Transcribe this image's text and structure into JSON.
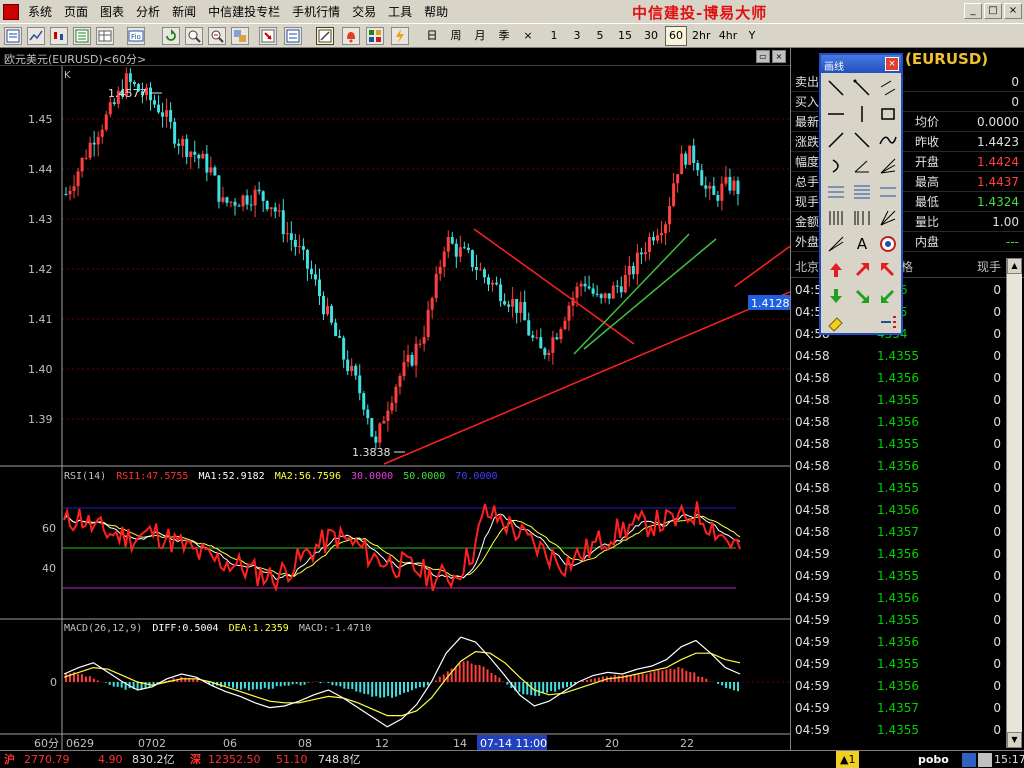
{
  "menu": {
    "items": [
      "系统",
      "页面",
      "图表",
      "分析",
      "新闻",
      "中信建投专栏",
      "手机行情",
      "交易",
      "工具",
      "帮助"
    ],
    "brand": "中信建投-博易大师"
  },
  "window_buttons": [
    "_",
    "□",
    "×"
  ],
  "toolbar": {
    "periods": [
      "日",
      "周",
      "月",
      "季",
      "×",
      "1",
      "3",
      "5",
      "15",
      "30",
      "60",
      "2hr",
      "4hr",
      "Y"
    ],
    "active_period": "60"
  },
  "chart": {
    "title": "欧元美元(EURUSD)<60分>",
    "k_label": "K",
    "high_label": "1.4577",
    "low_label": "1.3838",
    "current_price_label": "1.4128",
    "period_label": "60分",
    "cursor_time": "07-14 11:00",
    "rsi_header": {
      "name": "RSI(14)",
      "rsi1": "RSI1:47.5755",
      "ma1": "MA1:52.9182",
      "ma2": "MA2:56.7596",
      "l30": "30.0000",
      "l50": "50.0000",
      "l70": "70.0000"
    },
    "macd_header": {
      "name": "MACD(26,12,9)",
      "diff": "DIFF:0.5004",
      "dea": "DEA:1.2359",
      "macd": "MACD:-1.4710"
    },
    "colors": {
      "up": "#40e0e0",
      "down": "#ff4040",
      "grid": "#800000",
      "axis_text": "#c0c0c0",
      "rsi_line": "#ff2020",
      "ma1": "#ffffff",
      "ma2": "#ffff40"
    }
  },
  "chart_data": {
    "type": "candlestick",
    "symbol": "EURUSD",
    "interval": "60分",
    "price_axis": {
      "ticks": [
        "1.45",
        "1.44",
        "1.43",
        "1.42",
        "1.41",
        "1.40",
        "1.39"
      ],
      "range": [
        1.381,
        1.459
      ]
    },
    "time_axis_ticks": [
      "0629",
      "0702",
      "06",
      "08",
      "12",
      "14",
      "20",
      "22"
    ],
    "price_path": [
      [
        0,
        1.435
      ],
      [
        12,
        1.44
      ],
      [
        28,
        1.447
      ],
      [
        45,
        1.452
      ],
      [
        58,
        1.4577
      ],
      [
        75,
        1.455
      ],
      [
        92,
        1.452
      ],
      [
        108,
        1.446
      ],
      [
        125,
        1.443
      ],
      [
        140,
        1.44
      ],
      [
        152,
        1.433
      ],
      [
        168,
        1.434
      ],
      [
        185,
        1.435
      ],
      [
        200,
        1.433
      ],
      [
        212,
        1.428
      ],
      [
        225,
        1.424
      ],
      [
        240,
        1.418
      ],
      [
        255,
        1.41
      ],
      [
        270,
        1.402
      ],
      [
        282,
        1.397
      ],
      [
        292,
        1.392
      ],
      [
        300,
        1.3838
      ],
      [
        310,
        1.392
      ],
      [
        322,
        1.398
      ],
      [
        335,
        1.402
      ],
      [
        348,
        1.408
      ],
      [
        358,
        1.416
      ],
      [
        368,
        1.426
      ],
      [
        378,
        1.424
      ],
      [
        392,
        1.422
      ],
      [
        408,
        1.418
      ],
      [
        425,
        1.415
      ],
      [
        440,
        1.412
      ],
      [
        452,
        1.406
      ],
      [
        462,
        1.403
      ],
      [
        475,
        1.407
      ],
      [
        488,
        1.413
      ],
      [
        502,
        1.418
      ],
      [
        518,
        1.413
      ],
      [
        532,
        1.416
      ],
      [
        548,
        1.419
      ],
      [
        560,
        1.424
      ],
      [
        572,
        1.428
      ],
      [
        582,
        1.43
      ],
      [
        592,
        1.44
      ],
      [
        602,
        1.443
      ],
      [
        612,
        1.442
      ],
      [
        620,
        1.436
      ],
      [
        628,
        1.434
      ],
      [
        636,
        1.436
      ],
      [
        644,
        1.437
      ],
      [
        652,
        1.436
      ]
    ],
    "trendlines": [
      {
        "name": "support",
        "from": [
          320,
          1.381
        ],
        "to": [
          780,
          1.42
        ],
        "color": "#ff2020"
      },
      {
        "name": "resistance",
        "from": [
          410,
          1.428
        ],
        "to": [
          570,
          1.405
        ],
        "color": "#ff2020"
      },
      {
        "name": "fan-1",
        "from": [
          510,
          1.403
        ],
        "to": [
          625,
          1.427
        ],
        "color": "#40c040"
      },
      {
        "name": "fan-2",
        "from": [
          520,
          1.404
        ],
        "to": [
          652,
          1.426
        ],
        "color": "#40c040"
      }
    ],
    "rsi": {
      "axis_ticks": [
        "60",
        "40"
      ],
      "levels": {
        "70": "#2020c0",
        "50": "#20c020",
        "30": "#c020c0"
      },
      "path": [
        [
          0,
          62
        ],
        [
          15,
          66
        ],
        [
          30,
          60
        ],
        [
          50,
          57
        ],
        [
          70,
          55
        ],
        [
          90,
          58
        ],
        [
          110,
          53
        ],
        [
          130,
          48
        ],
        [
          150,
          44
        ],
        [
          170,
          42
        ],
        [
          190,
          38
        ],
        [
          210,
          35
        ],
        [
          230,
          42
        ],
        [
          250,
          50
        ],
        [
          270,
          56
        ],
        [
          290,
          52
        ],
        [
          310,
          45
        ],
        [
          330,
          42
        ],
        [
          350,
          40
        ],
        [
          370,
          35
        ],
        [
          390,
          36
        ],
        [
          410,
          50
        ],
        [
          420,
          68
        ],
        [
          440,
          63
        ],
        [
          460,
          55
        ],
        [
          480,
          48
        ],
        [
          500,
          42
        ],
        [
          520,
          48
        ],
        [
          540,
          55
        ],
        [
          560,
          60
        ],
        [
          580,
          62
        ],
        [
          600,
          63
        ],
        [
          615,
          64
        ],
        [
          630,
          68
        ],
        [
          645,
          62
        ],
        [
          660,
          55
        ],
        [
          675,
          50
        ]
      ]
    },
    "macd": {
      "axis_ticks": [
        "0"
      ],
      "histogram": [
        0.6,
        0.5,
        0.2,
        -0.2,
        -0.4,
        -0.5,
        -0.3,
        0.1,
        0.3,
        0.2,
        -0.1,
        -0.3,
        -0.4,
        -0.5,
        -0.4,
        -0.3,
        -0.2,
        -0.1,
        0.0,
        -0.2,
        -0.5,
        -0.8,
        -1.0,
        -0.9,
        -0.6,
        -0.3,
        0.2,
        0.9,
        1.3,
        1.0,
        0.5,
        -0.3,
        -0.8,
        -0.9,
        -0.6,
        -0.3,
        0.1,
        0.3,
        0.4,
        0.5,
        0.5,
        0.6,
        0.8,
        0.9,
        0.5,
        0.1,
        -0.3,
        -0.6
      ],
      "diff": [
        0.5,
        0.9,
        1.2,
        0.6,
        0.0,
        -0.5,
        -0.3,
        0.2,
        0.5,
        0.3,
        -0.2,
        -0.6,
        -0.9,
        -1.3,
        -1.6,
        -1.5,
        -1.2,
        -0.8,
        -0.5,
        -1.0,
        -1.6,
        -2.2,
        -2.8,
        -2.3,
        -1.4,
        0.0,
        1.8,
        2.8,
        2.5,
        1.5,
        0.4,
        -0.8,
        -1.5,
        -1.2,
        -0.6,
        0.0,
        0.4,
        0.6,
        0.5,
        0.8,
        1.0,
        1.4,
        2.2,
        2.6,
        1.8,
        0.9,
        0.5
      ],
      "dea": [
        0.3,
        0.6,
        0.9,
        0.8,
        0.4,
        0.0,
        -0.2,
        0.0,
        0.2,
        0.2,
        0.0,
        -0.3,
        -0.6,
        -0.9,
        -1.2,
        -1.3,
        -1.3,
        -1.1,
        -0.9,
        -1.0,
        -1.3,
        -1.7,
        -2.1,
        -2.1,
        -1.8,
        -1.0,
        0.2,
        1.3,
        1.9,
        1.8,
        1.2,
        0.3,
        -0.5,
        -0.8,
        -0.7,
        -0.4,
        -0.1,
        0.2,
        0.3,
        0.5,
        0.7,
        0.9,
        1.4,
        1.8,
        1.8,
        1.4,
        1.2
      ]
    }
  },
  "quote_panel": {
    "title": "(EURUSD)",
    "rows": [
      {
        "l1": "卖出",
        "v1": "",
        "l2": "",
        "v2": "0",
        "c2": "#e0e0e0"
      },
      {
        "l1": "买入",
        "v1": "",
        "l2": "",
        "v2": "0",
        "c2": "#e0e0e0"
      },
      {
        "l1": "最新",
        "v1": "",
        "l2": "均价",
        "v2": "0.0000",
        "c2": "#e0e0e0"
      },
      {
        "l1": "涨跌",
        "v1": "",
        "l2": "昨收",
        "v2": "1.4423",
        "c2": "#e0e0e0"
      },
      {
        "l1": "幅度",
        "v1": "",
        "l2": "开盘",
        "v2": "1.4424",
        "c2": "#ff4040"
      },
      {
        "l1": "总手",
        "v1": "",
        "l2": "最高",
        "v2": "1.4437",
        "c2": "#ff4040"
      },
      {
        "l1": "现手",
        "v1": "",
        "l2": "最低",
        "v2": "1.4324",
        "c2": "#40e040"
      },
      {
        "l1": "金额",
        "v1": "",
        "l2": "量比",
        "v2": "1.00",
        "c2": "#e0e0e0"
      },
      {
        "l1": "外盘",
        "v1": "",
        "l2": "内盘",
        "v2": "---",
        "c2": "#40e040"
      }
    ],
    "ticks_header": {
      "time": "北京",
      "price": "格",
      "qty": "现手"
    },
    "ticks": [
      {
        "t": "04:58",
        "p": "4356",
        "q": "0"
      },
      {
        "t": "04:58",
        "p": "4355",
        "q": "0"
      },
      {
        "t": "04:58",
        "p": "4354",
        "q": "0"
      },
      {
        "t": "04:58",
        "p": "1.4355",
        "q": "0"
      },
      {
        "t": "04:58",
        "p": "1.4356",
        "q": "0"
      },
      {
        "t": "04:58",
        "p": "1.4355",
        "q": "0"
      },
      {
        "t": "04:58",
        "p": "1.4356",
        "q": "0"
      },
      {
        "t": "04:58",
        "p": "1.4355",
        "q": "0"
      },
      {
        "t": "04:58",
        "p": "1.4356",
        "q": "0"
      },
      {
        "t": "04:58",
        "p": "1.4355",
        "q": "0"
      },
      {
        "t": "04:58",
        "p": "1.4356",
        "q": "0"
      },
      {
        "t": "04:58",
        "p": "1.4357",
        "q": "0"
      },
      {
        "t": "04:59",
        "p": "1.4356",
        "q": "0"
      },
      {
        "t": "04:59",
        "p": "1.4355",
        "q": "0"
      },
      {
        "t": "04:59",
        "p": "1.4356",
        "q": "0"
      },
      {
        "t": "04:59",
        "p": "1.4355",
        "q": "0"
      },
      {
        "t": "04:59",
        "p": "1.4356",
        "q": "0"
      },
      {
        "t": "04:59",
        "p": "1.4355",
        "q": "0"
      },
      {
        "t": "04:59",
        "p": "1.4356",
        "q": "0"
      },
      {
        "t": "04:59",
        "p": "1.4357",
        "q": "0"
      },
      {
        "t": "04:59",
        "p": "1.4355",
        "q": "0"
      }
    ]
  },
  "draw_palette": {
    "title": "画线",
    "text_tool": "A"
  },
  "statusbar": {
    "sh_label": "沪",
    "sh_index": "2770.79",
    "sh_change": "4.90",
    "sh_amount": "830.2亿",
    "sz_label": "深",
    "sz_index": "12352.50",
    "sz_change": "51.10",
    "sz_amount": "748.8亿",
    "alert": "▲1",
    "brand": "pobo",
    "clock": "15:17"
  }
}
